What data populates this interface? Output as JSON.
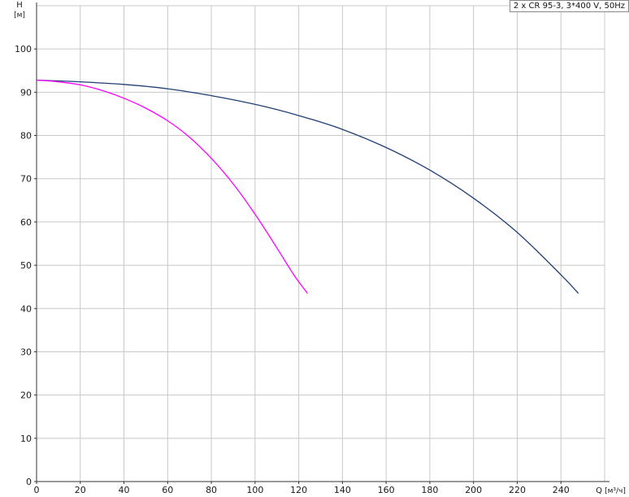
{
  "chart_data": {
    "type": "line",
    "title": "2 x CR 95-3, 3*400 V, 50Hz",
    "ylabel": "H",
    "yunit": "[м]",
    "xlabel": "Q",
    "xunit": "[м³/ч]",
    "xlim": [
      0,
      260
    ],
    "ylim": [
      0,
      110
    ],
    "x_ticks": [
      0,
      20,
      40,
      60,
      80,
      100,
      120,
      140,
      160,
      180,
      200,
      220,
      240
    ],
    "y_ticks": [
      0,
      10,
      20,
      30,
      40,
      50,
      60,
      70,
      80,
      90,
      100
    ],
    "grid": true,
    "series": [
      {
        "color": "#1f3f75",
        "points": [
          [
            0,
            92.8
          ],
          [
            20,
            92.4
          ],
          [
            40,
            91.8
          ],
          [
            60,
            90.8
          ],
          [
            80,
            89.2
          ],
          [
            100,
            87.2
          ],
          [
            120,
            84.6
          ],
          [
            140,
            81.4
          ],
          [
            160,
            77.2
          ],
          [
            180,
            72.0
          ],
          [
            200,
            65.5
          ],
          [
            220,
            57.6
          ],
          [
            240,
            47.8
          ],
          [
            248,
            43.5
          ]
        ]
      },
      {
        "color": "#ff00ff",
        "points": [
          [
            0,
            92.8
          ],
          [
            10,
            92.4
          ],
          [
            20,
            91.7
          ],
          [
            30,
            90.4
          ],
          [
            40,
            88.6
          ],
          [
            50,
            86.3
          ],
          [
            60,
            83.4
          ],
          [
            70,
            79.6
          ],
          [
            80,
            74.7
          ],
          [
            90,
            68.8
          ],
          [
            100,
            61.8
          ],
          [
            110,
            54.0
          ],
          [
            118,
            47.6
          ],
          [
            124,
            43.5
          ]
        ]
      }
    ]
  }
}
